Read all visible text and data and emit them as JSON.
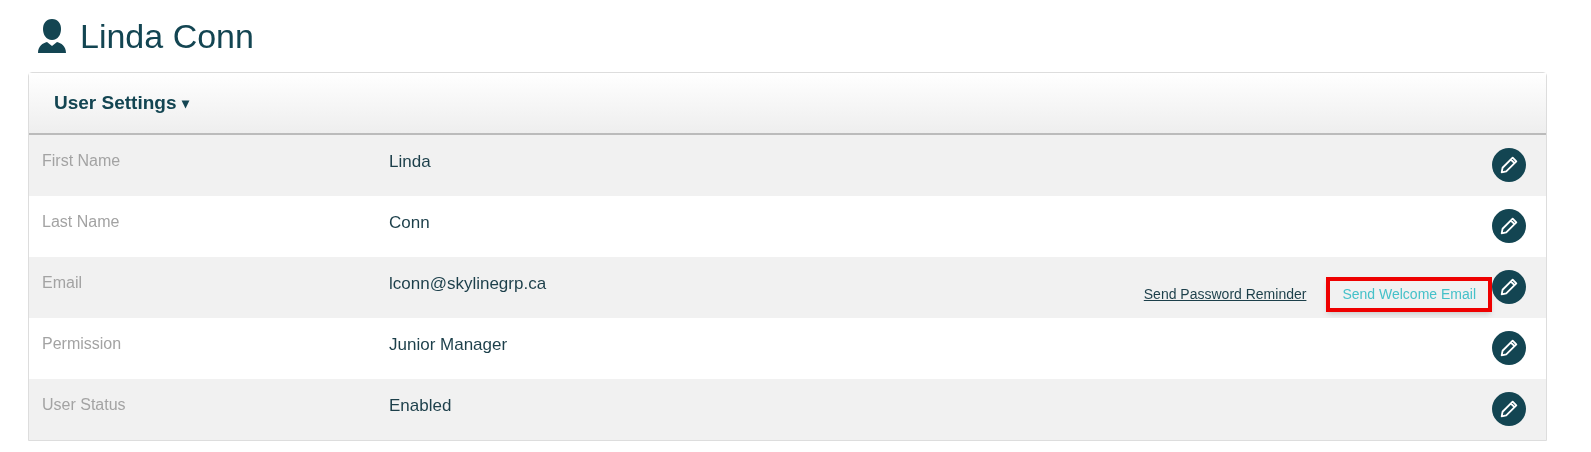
{
  "title": "Linda Conn",
  "panel": {
    "heading": "User Settings",
    "caret": "▾"
  },
  "rows": [
    {
      "label": "First Name",
      "value": "Linda"
    },
    {
      "label": "Last Name",
      "value": "Conn"
    },
    {
      "label": "Email",
      "value": "lconn@skylinegrp.ca",
      "links": [
        {
          "text": "Send Password Reminder",
          "kind": "underlined",
          "highlighted": false
        },
        {
          "text": "Send Welcome Email",
          "kind": "hover",
          "highlighted": true
        }
      ]
    },
    {
      "label": "Permission",
      "value": "Junior Manager"
    },
    {
      "label": "User Status",
      "value": "Enabled"
    }
  ]
}
